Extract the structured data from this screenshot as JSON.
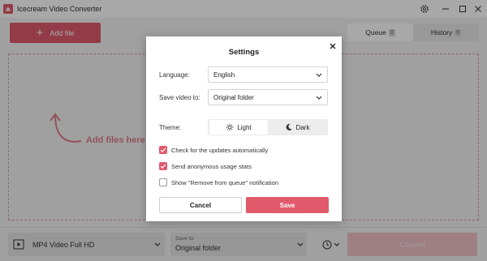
{
  "app": {
    "title": "Icecream Video Converter"
  },
  "toolbar": {
    "add_file_label": "Add file",
    "tabs": [
      {
        "label": "Queue",
        "count": "0",
        "active": true
      },
      {
        "label": "History",
        "count": "0",
        "active": false
      }
    ]
  },
  "main": {
    "drop_hint": "Add files here"
  },
  "bottombar": {
    "format_value": "MP4 Video Full HD",
    "save_to_caption": "Save to:",
    "save_to_value": "Original folder",
    "convert_label": "Convert"
  },
  "settings": {
    "title": "Settings",
    "language_label": "Language:",
    "language_value": "English",
    "save_video_label": "Save video to:",
    "save_video_value": "Original folder",
    "theme_label": "Theme:",
    "theme_light": "Light",
    "theme_dark": "Dark",
    "theme_selected": "Light",
    "options": [
      {
        "label": "Check for the updates automatically",
        "checked": true
      },
      {
        "label": "Send anonymous usage stats",
        "checked": true
      },
      {
        "label": "Show \"Remove from queue\" notification",
        "checked": false
      }
    ],
    "cancel_label": "Cancel",
    "save_label": "Save"
  },
  "colors": {
    "accent": "#e05a6c",
    "accent_disabled": "#f0c3c9"
  },
  "icons": [
    "app-logo-icon",
    "settings-gear-icon",
    "minimize-icon",
    "maximize-icon",
    "window-close-icon",
    "plus-icon",
    "curved-arrow-icon",
    "video-file-icon",
    "chevron-down-icon",
    "timer-icon",
    "close-icon",
    "sun-icon",
    "moon-icon",
    "checkmark-icon"
  ]
}
